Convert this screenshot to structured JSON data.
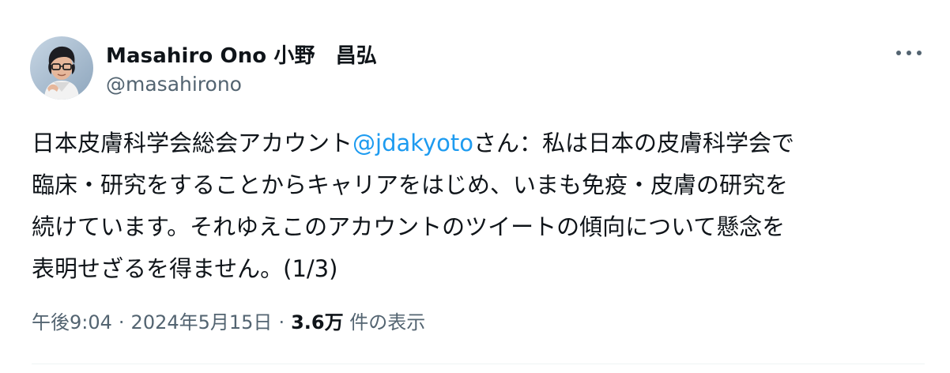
{
  "author": {
    "display_name": "Masahiro Ono 小野　昌弘",
    "handle": "@masahirono",
    "avatar_icon": "person-photo-avatar"
  },
  "more_icon": "more-horizontal-icon",
  "tweet": {
    "line1_before": "日本皮膚科学会総会アカウント",
    "mention": "@jdakyoto",
    "line1_after": "さん：私は日本の皮膚科学会で",
    "line2": "臨床・研究をすることからキャリアをはじめ、いまも免疫・皮膚の研究を",
    "line3": "続けています。それゆえこのアカウントのツイートの傾向について懸念を",
    "line4": "表明せざるを得ません。(1/3)"
  },
  "meta": {
    "time": "午後9:04",
    "separator": "·",
    "date": "2024年5月15日",
    "views_count": "3.6万",
    "views_label": "件の表示"
  },
  "colors": {
    "text": "#0f1419",
    "secondary": "#536471",
    "link": "#1d9bf0",
    "divider": "#eff3f4"
  }
}
